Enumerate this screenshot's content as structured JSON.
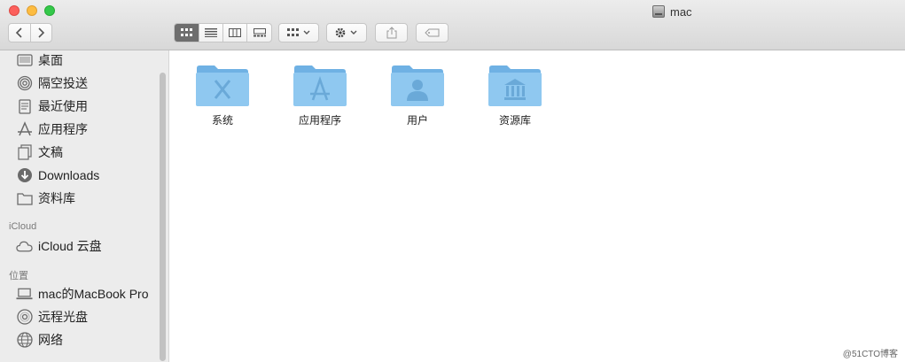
{
  "window": {
    "title": "mac"
  },
  "toolbar": {
    "views": [
      "icon-view",
      "list-view",
      "column-view",
      "gallery-view"
    ],
    "active_view": "icon-view"
  },
  "sidebar": {
    "favorites": [
      {
        "label": "桌面",
        "icon": "desktop-icon"
      },
      {
        "label": "隔空投送",
        "icon": "airdrop-icon"
      },
      {
        "label": "最近使用",
        "icon": "recents-icon"
      },
      {
        "label": "应用程序",
        "icon": "applications-icon"
      },
      {
        "label": "文稿",
        "icon": "documents-icon"
      },
      {
        "label": "Downloads",
        "icon": "downloads-icon"
      },
      {
        "label": "资料库",
        "icon": "folder-icon"
      }
    ],
    "icloud_header": "iCloud",
    "icloud": [
      {
        "label": "iCloud 云盘",
        "icon": "cloud-icon"
      }
    ],
    "locations_header": "位置",
    "locations": [
      {
        "label": "mac的MacBook Pro",
        "icon": "laptop-icon"
      },
      {
        "label": "远程光盘",
        "icon": "disc-icon"
      },
      {
        "label": "网络",
        "icon": "network-icon"
      }
    ]
  },
  "folders": [
    {
      "label": "系统",
      "icon": "system-folder-icon"
    },
    {
      "label": "应用程序",
      "icon": "applications-folder-icon"
    },
    {
      "label": "用户",
      "icon": "users-folder-icon"
    },
    {
      "label": "资源库",
      "icon": "library-folder-icon"
    }
  ],
  "colors": {
    "folder": "#8fc8f0",
    "folder_dark": "#6fb1e4",
    "sidebar_bg": "#ececec"
  },
  "watermark": "@51CTO博客"
}
